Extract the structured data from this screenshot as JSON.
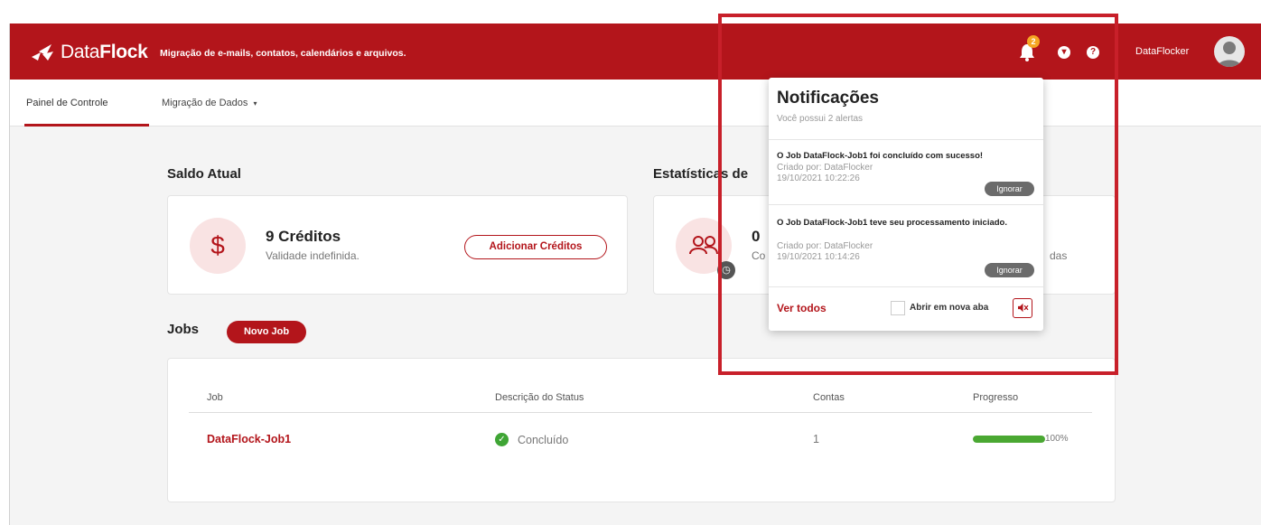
{
  "app": {
    "logo_text_light": "Data",
    "logo_text_bold": "Flock",
    "tagline": "Migração de e-mails, contatos, calendários e arquivos.",
    "notification_badge": "2",
    "username": "DataFlocker",
    "brand_color": "#b3151b"
  },
  "nav": {
    "tabs": [
      {
        "label": "Painel de Controle",
        "active": true
      },
      {
        "label": "Migração de Dados",
        "icon": "caret-down-icon"
      }
    ]
  },
  "balance": {
    "title": "Saldo Atual",
    "credits": "9 Créditos",
    "validity": "Validade indefinida.",
    "add_button": "Adicionar Créditos"
  },
  "stats": {
    "title_visible": "Estatísticas de",
    "count": "0",
    "label_partial": "Co",
    "label_partial_right": "das"
  },
  "jobs": {
    "title": "Jobs",
    "new_job_button": "Novo Job",
    "columns": [
      "Job",
      "Descrição do Status",
      "Contas",
      "Progresso"
    ],
    "rows": [
      {
        "name": "DataFlock-Job1",
        "status": "Concluído",
        "accounts": "1",
        "progress_percent": 100,
        "progress_label": "100%"
      }
    ]
  },
  "notifications": {
    "title": "Notificações",
    "subtitle": "Você possui 2 alertas",
    "items": [
      {
        "title": "O Job DataFlock-Job1 foi concluído com sucesso!",
        "created_by": "Criado por: DataFlocker",
        "timestamp": "19/10/2021 10:22:26",
        "ignore_label": "Ignorar"
      },
      {
        "title": "O Job DataFlock-Job1 teve seu processamento iniciado.",
        "created_by": "Criado por: DataFlocker",
        "timestamp": "19/10/2021 10:14:26",
        "ignore_label": "Ignorar"
      }
    ],
    "view_all": "Ver todos",
    "open_new_tab": "Abrir em nova aba"
  }
}
